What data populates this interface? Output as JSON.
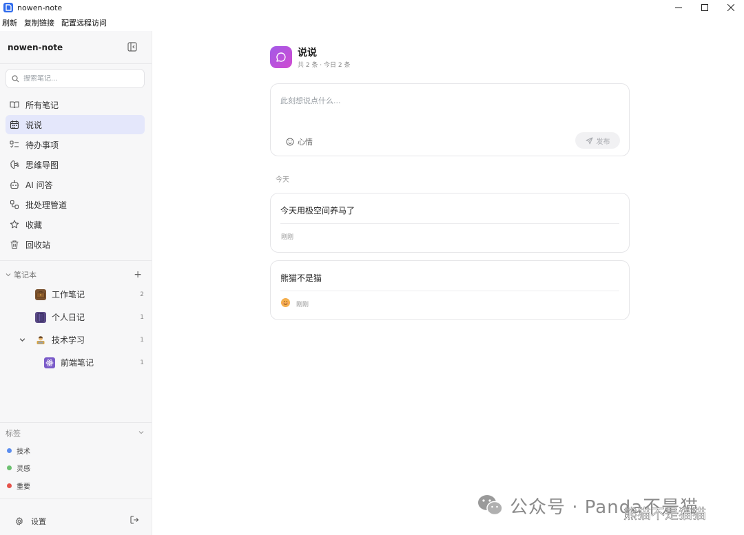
{
  "window": {
    "title": "nowen-note"
  },
  "menubar": {
    "items": [
      "刷新",
      "复制链接",
      "配置远程访问"
    ]
  },
  "sidebar": {
    "header": "nowen-note",
    "search_placeholder": "搜索笔记...",
    "nav": [
      {
        "label": "所有笔记",
        "icon": "book-open-icon",
        "active": false
      },
      {
        "label": "说说",
        "icon": "calendar-icon",
        "active": true
      },
      {
        "label": "待办事项",
        "icon": "list-todo-icon",
        "active": false
      },
      {
        "label": "思维导图",
        "icon": "brain-icon",
        "active": false
      },
      {
        "label": "AI 问答",
        "icon": "bot-icon",
        "active": false
      },
      {
        "label": "批处理管道",
        "icon": "workflow-icon",
        "active": false
      },
      {
        "label": "收藏",
        "icon": "star-icon",
        "active": false
      },
      {
        "label": "回收站",
        "icon": "trash-icon",
        "active": false
      }
    ],
    "notebooks_header": "笔记本",
    "notebooks": [
      {
        "label": "工作笔记",
        "icon": "briefcase-icon",
        "count": "2"
      },
      {
        "label": "个人日记",
        "icon": "notebook-icon",
        "count": "1"
      },
      {
        "label": "技术学习",
        "icon": "technologist-icon",
        "count": "1"
      },
      {
        "label": "前端笔记",
        "icon": "atom-icon",
        "count": "1"
      }
    ],
    "tags_header": "标签",
    "tags": [
      {
        "label": "技术",
        "color": "#5b8def"
      },
      {
        "label": "灵感",
        "color": "#6cc070"
      },
      {
        "label": "重要",
        "color": "#e5534b"
      }
    ],
    "settings_label": "设置"
  },
  "main": {
    "title": "说说",
    "subtitle": "共 2 条 · 今日 2 条",
    "composer": {
      "placeholder": "此刻想说点什么...",
      "mood_label": "心情",
      "publish_label": "发布"
    },
    "date_group": "今天",
    "posts": [
      {
        "content": "今天用极空间养马了",
        "time": "刚刚",
        "mood": null
      },
      {
        "content": "熊猫不是猫",
        "time": "刚刚",
        "mood": "smiling-face-icon"
      }
    ]
  },
  "watermark": {
    "text": "公众号 · Panda不是猫",
    "subtext": "熊猫不是猫猫"
  },
  "colors": {
    "accent": "#2f6bed",
    "active_nav_bg": "#e4e7fb",
    "page_icon_gradient": [
      "#a25ae8",
      "#d04bd0"
    ]
  }
}
